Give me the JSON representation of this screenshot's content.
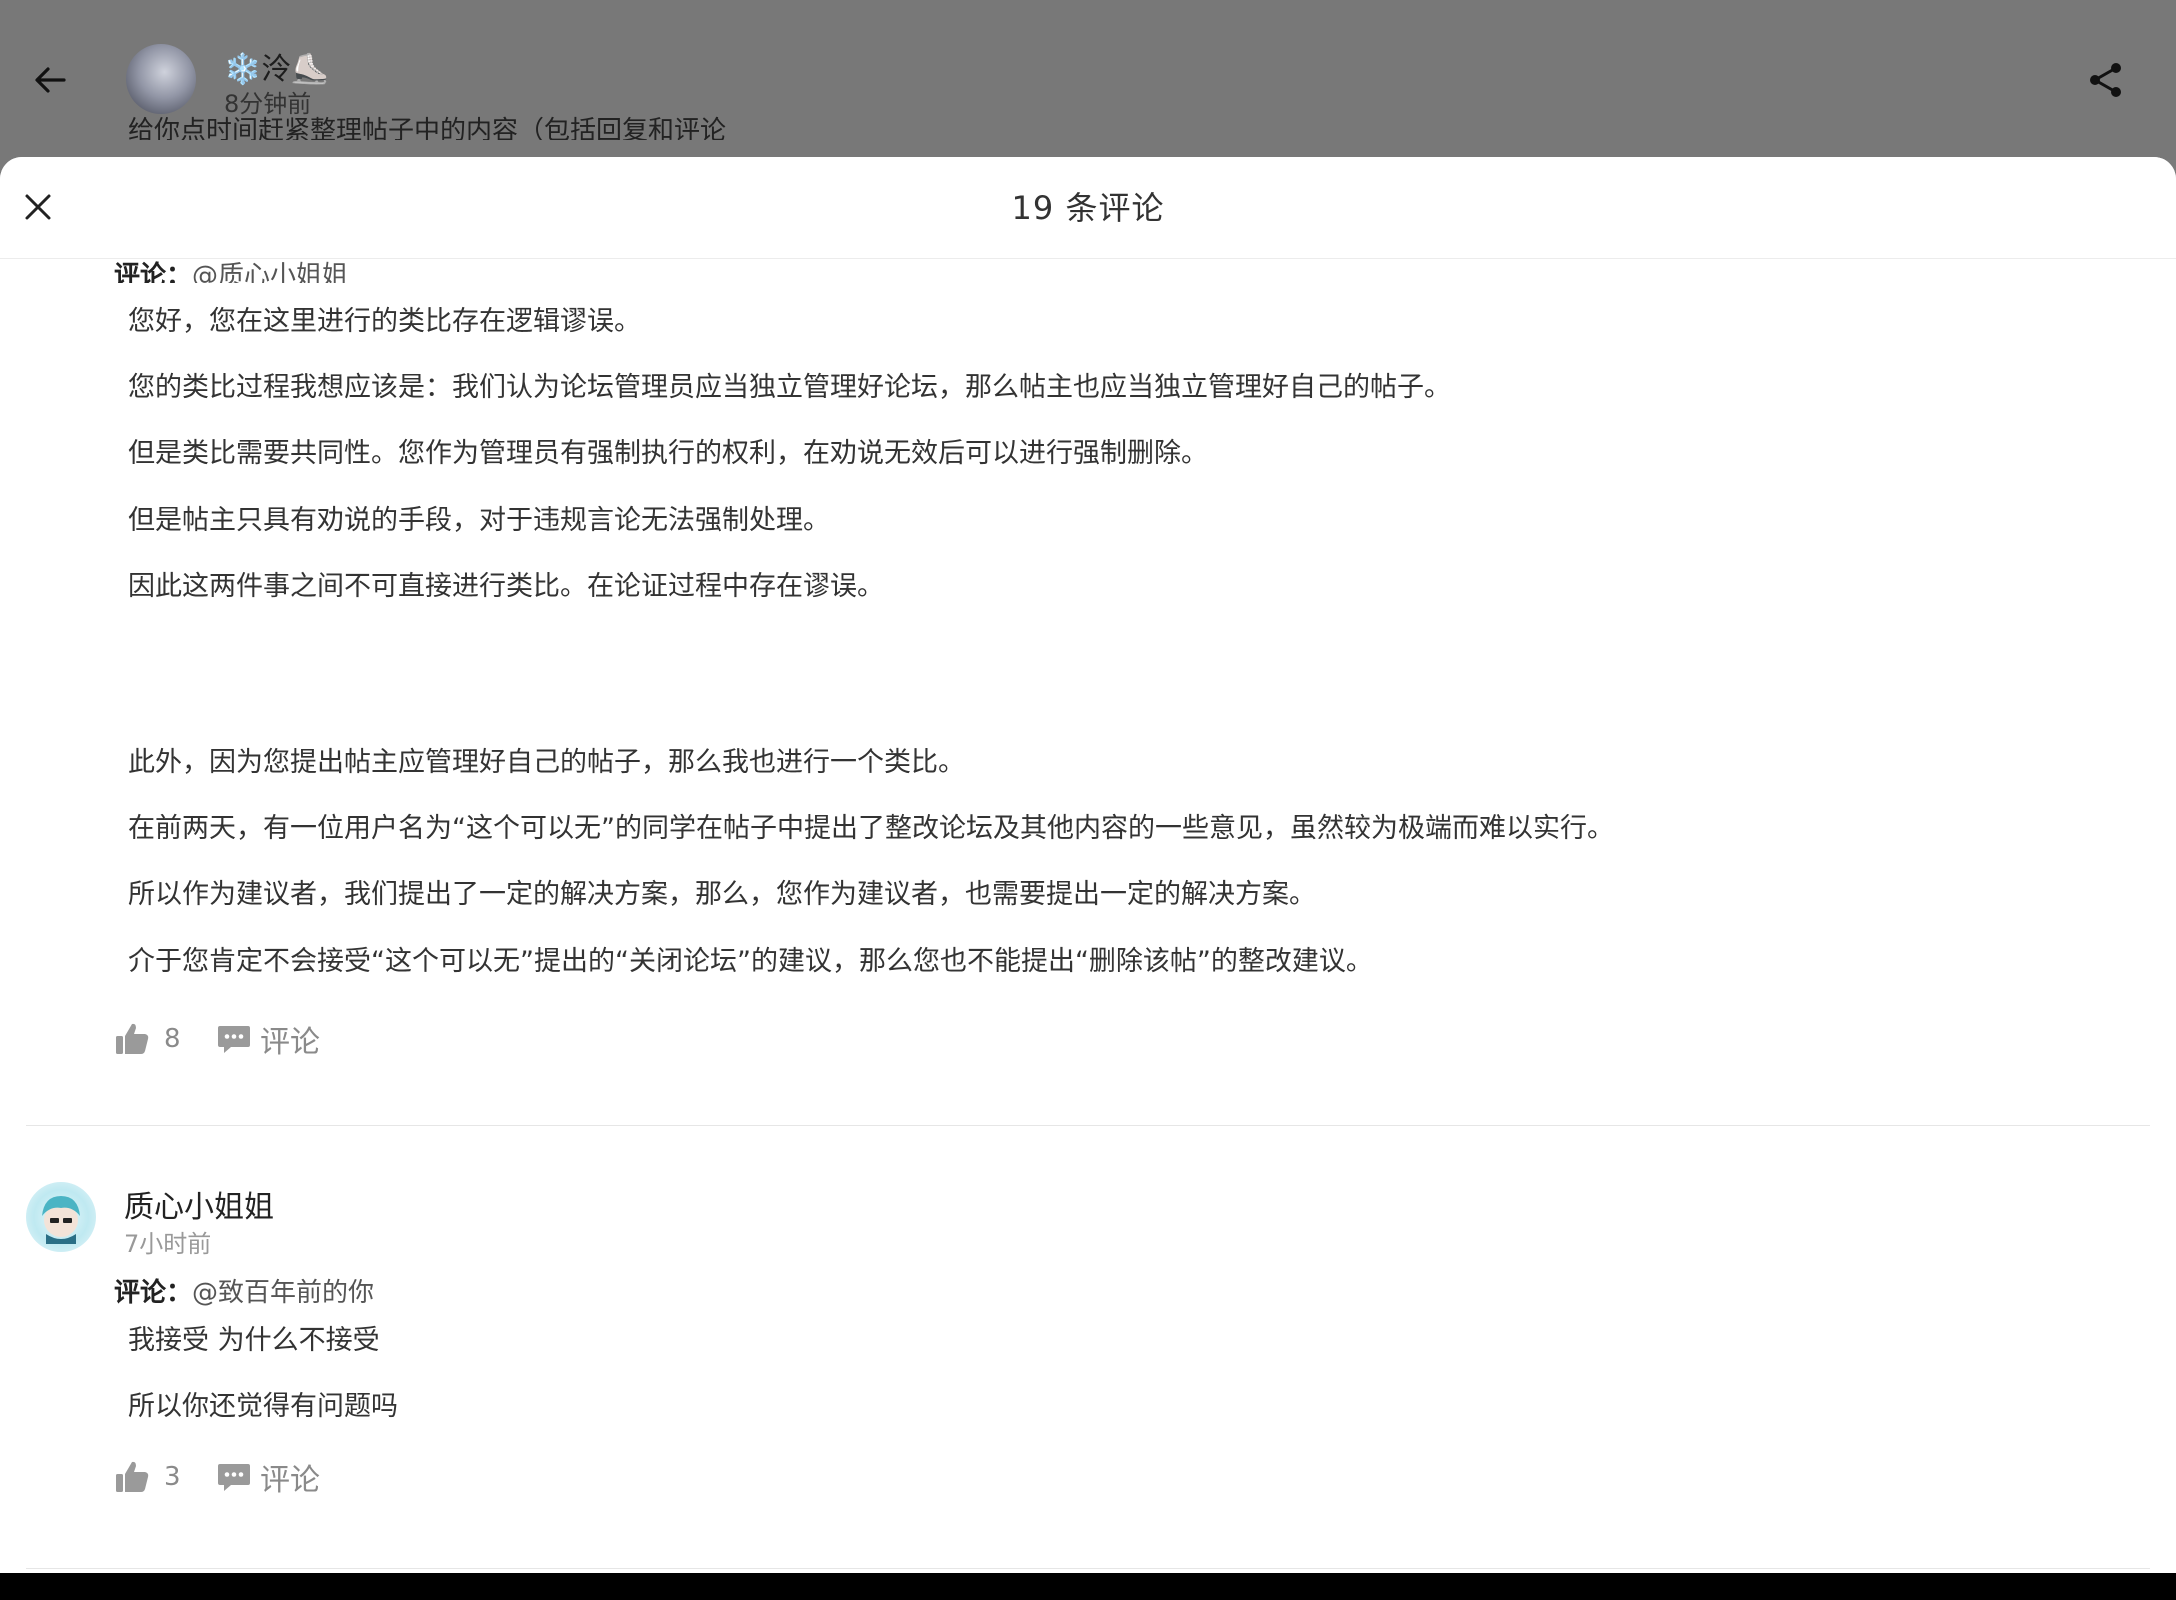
{
  "background_post": {
    "author": "❄️泠⛸️",
    "author_snow": "❄️",
    "author_name": "泠⛸️",
    "time": "8分钟前",
    "snippet": "给你点时间赶紧整理帖子中的内容（包括回复和评论"
  },
  "sheet": {
    "title": "19 条评论"
  },
  "comments": [
    {
      "reply_label": "评论：",
      "reply_to": "@质心小姐姐",
      "lines": [
        "您好，您在这里进行的类比存在逻辑谬误。",
        "您的类比过程我想应该是：我们认为论坛管理员应当独立管理好论坛，那么帖主也应当独立管理好自己的帖子。",
        "但是类比需要共同性。您作为管理员有强制执行的权利，在劝说无效后可以进行强制删除。",
        "但是帖主只具有劝说的手段，对于违规言论无法强制处理。",
        "因此这两件事之间不可直接进行类比。在论证过程中存在谬误。",
        "此外，因为您提出帖主应管理好自己的帖子，那么我也进行一个类比。",
        "在前两天，有一位用户名为“这个可以无”的同学在帖子中提出了整改论坛及其他内容的一些意见，虽然较为极端而难以实行。",
        "所以作为建议者，我们提出了一定的解决方案，那么，您作为建议者，也需要提出一定的解决方案。",
        "介于您肯定不会接受“这个可以无”提出的“关闭论坛”的建议，那么您也不能提出“删除该帖”的整改建议。"
      ],
      "likes": "8",
      "comment_label": "评论"
    },
    {
      "user": "质心小姐姐",
      "time": "7小时前",
      "reply_label": "评论：",
      "reply_to": "@致百年前的你",
      "lines": [
        "我接受 为什么不接受",
        "所以你还觉得有问题吗"
      ],
      "likes": "3",
      "comment_label": "评论"
    }
  ],
  "icons": {
    "back": "arrow-left-icon",
    "share": "share-icon",
    "close": "close-icon",
    "like": "thumbs-up-icon",
    "comment": "comment-bubble-icon"
  }
}
